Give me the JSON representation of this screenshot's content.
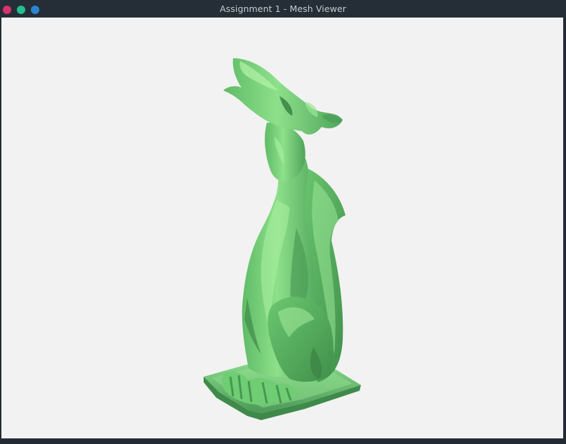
{
  "window": {
    "title": "Assignment 1 - Mesh Viewer",
    "controls": {
      "close_color": "#d6336c",
      "minimize_color": "#1fbf8f",
      "maximize_color": "#2b83d1"
    }
  },
  "viewport": {
    "background": "#f2f2f2",
    "model": {
      "name": "gargoyle-mesh",
      "color": "#7fd27f"
    }
  }
}
